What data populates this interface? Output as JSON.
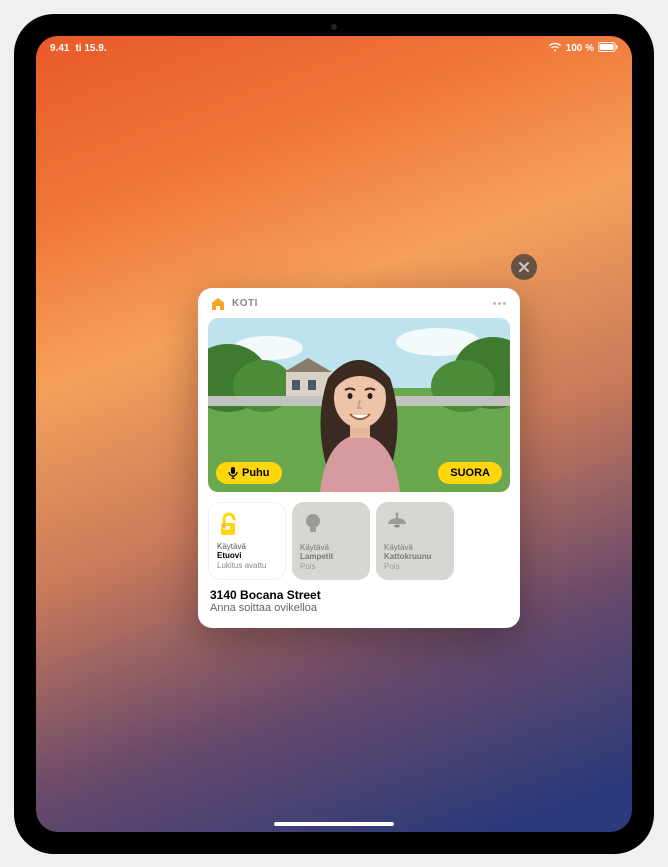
{
  "status_bar": {
    "time": "9.41",
    "date": "ti 15.9.",
    "wifi_signal": "●●●",
    "battery_pct": "100 %"
  },
  "card": {
    "app_name": "KOTI",
    "talk_label": "Puhu",
    "live_label": "SUORA",
    "tiles": [
      {
        "room": "Käytävä",
        "device": "Etuovi",
        "status": "Lukitus avattu",
        "icon": "lock-open-icon",
        "state": "unlocked"
      },
      {
        "room": "Käytävä",
        "device": "Lampetit",
        "status": "Pois",
        "icon": "bulb-icon",
        "state": "off"
      },
      {
        "room": "Käytävä",
        "device": "Kattokruunu",
        "status": "Pois",
        "icon": "chandelier-icon",
        "state": "off"
      }
    ],
    "address": "3140 Bocana Street",
    "subtitle": "Anna soittaa ovikelloa"
  },
  "colors": {
    "accent_yellow": "#ffd60a",
    "home_orange": "#f5a623"
  }
}
